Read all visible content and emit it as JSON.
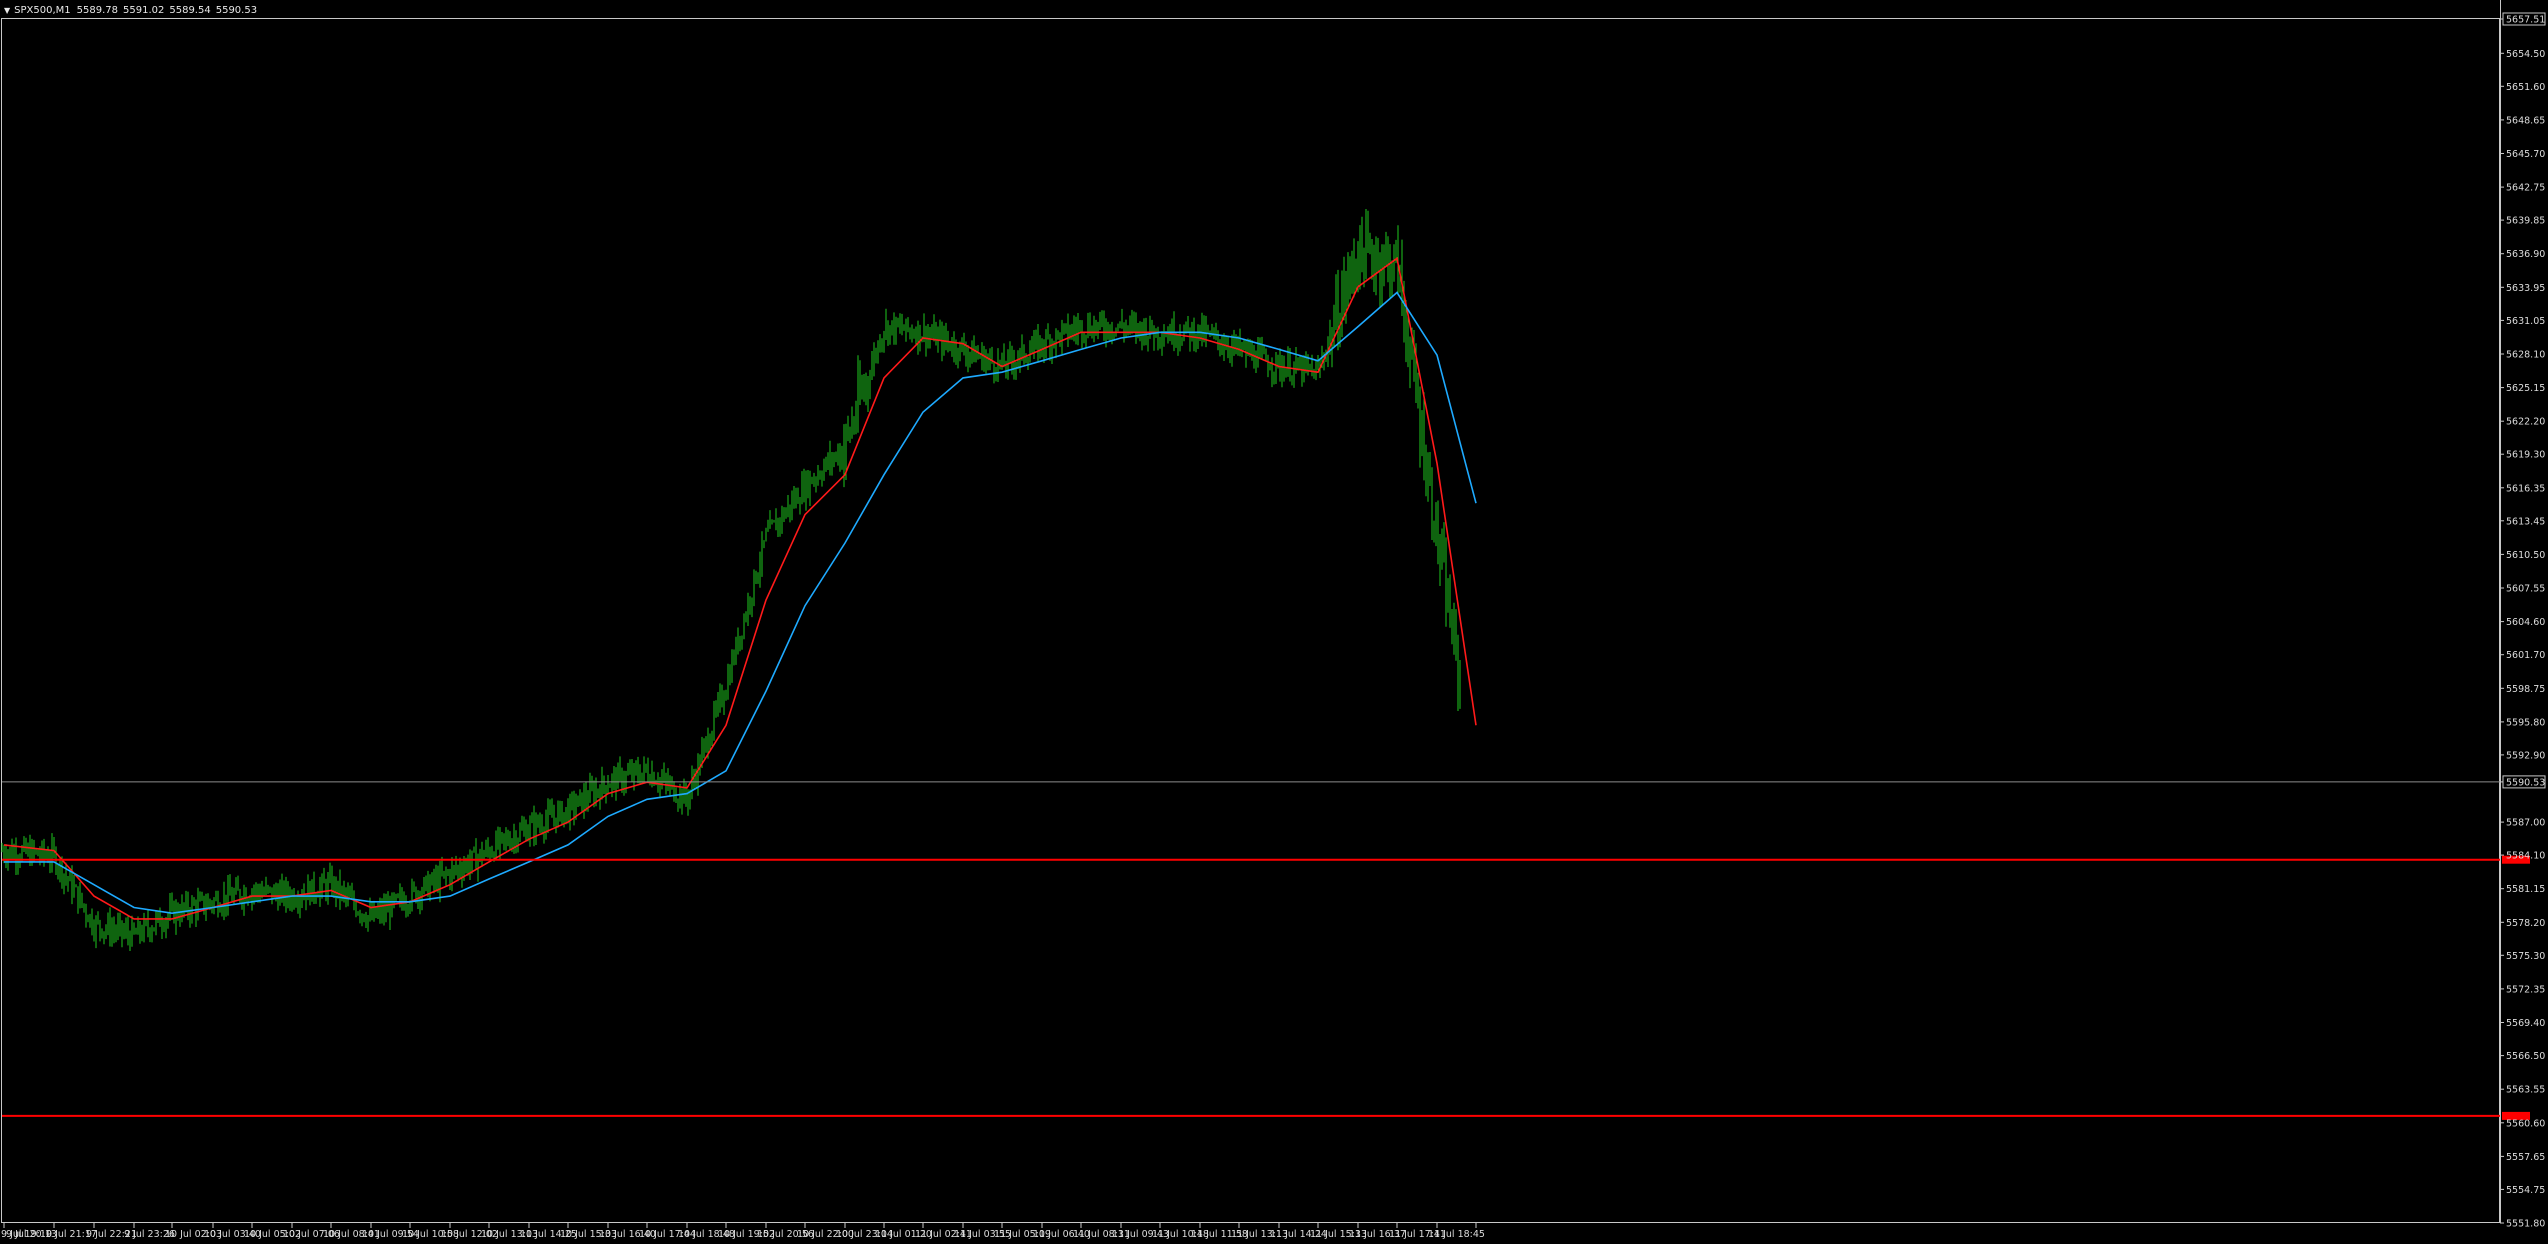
{
  "header": {
    "symbol": "SPX500,M1",
    "open": "5589.78",
    "high": "5591.02",
    "low": "5589.54",
    "close": "5590.53",
    "menu_icon": "triangle-down-icon"
  },
  "colors": {
    "background": "#000000",
    "frame": "#c8c8c8",
    "candles": "#1ec81e",
    "ma_fast": "#ff1a1a",
    "ma_slow": "#1eaaff",
    "h_lines": "#ff0000",
    "current_price_line": "#8c8c8c",
    "text": "#dcdcdc"
  },
  "price_axis": {
    "ticks": [
      "5657.51",
      "5654.50",
      "5651.60",
      "5648.65",
      "5645.70",
      "5642.75",
      "5639.85",
      "5636.90",
      "5633.95",
      "5631.05",
      "5628.10",
      "5625.15",
      "5622.20",
      "5619.30",
      "5616.35",
      "5613.45",
      "5610.50",
      "5607.55",
      "5604.60",
      "5601.70",
      "5598.75",
      "5595.80",
      "5592.90",
      "5590.53",
      "5587.00",
      "5584.10",
      "5581.15",
      "5578.20",
      "5575.30",
      "5572.35",
      "5569.40",
      "5566.50",
      "5563.55",
      "5560.60",
      "5557.65",
      "5554.75",
      "5551.80"
    ]
  },
  "time_axis": {
    "ticks": [
      "9 Jul 19:10",
      "9 Jul 20:13",
      "9 Jul 21:17",
      "9 Jul 22:21",
      "9 Jul 23:26",
      "10 Jul 02:03",
      "10 Jul 03:40",
      "10 Jul 05:02",
      "10 Jul 07:06",
      "10 Jul 08:41",
      "10 Jul 09:54",
      "10 Jul 10:58",
      "10 Jul 12:02",
      "10 Jul 13:13",
      "10 Jul 14:25",
      "10 Jul 15:33",
      "10 Jul 16:40",
      "10 Jul 17:44",
      "10 Jul 18:48",
      "10 Jul 19:52",
      "10 Jul 20:56",
      "10 Jul 22:00",
      "10 Jul 23:04",
      "11 Jul 01:20",
      "11 Jul 02:41",
      "11 Jul 03:55",
      "11 Jul 05:09",
      "11 Jul 06:40",
      "11 Jul 08:31",
      "11 Jul 09:43",
      "11 Jul 10:48",
      "11 Jul 11:58",
      "11 Jul 13:13",
      "11 Jul 14:24",
      "11 Jul 15:33",
      "11 Jul 16:37",
      "11 Jul 17:41",
      "11 Jul 18:45"
    ]
  },
  "chart_data": {
    "type": "line",
    "instrument": "SPX500",
    "timeframe": "M1",
    "ylim": [
      5551.8,
      5657.51
    ],
    "x": [
      "9 Jul 19:10",
      "9 Jul 20:13",
      "9 Jul 21:17",
      "9 Jul 22:21",
      "9 Jul 23:26",
      "10 Jul 02:03",
      "10 Jul 03:40",
      "10 Jul 05:02",
      "10 Jul 07:06",
      "10 Jul 08:41",
      "10 Jul 09:54",
      "10 Jul 10:58",
      "10 Jul 12:02",
      "10 Jul 13:13",
      "10 Jul 14:25",
      "10 Jul 15:33",
      "10 Jul 16:40",
      "10 Jul 17:44",
      "10 Jul 18:48",
      "10 Jul 19:52",
      "10 Jul 20:56",
      "10 Jul 22:00",
      "10 Jul 23:04",
      "11 Jul 01:20",
      "11 Jul 02:41",
      "11 Jul 03:55",
      "11 Jul 05:09",
      "11 Jul 06:40",
      "11 Jul 08:31",
      "11 Jul 09:43",
      "11 Jul 10:48",
      "11 Jul 11:58",
      "11 Jul 13:13",
      "11 Jul 14:24",
      "11 Jul 15:33",
      "11 Jul 16:37",
      "11 Jul 17:41",
      "11 Jul 18:45"
    ],
    "series": [
      {
        "values": [
          5584.5,
          5584.0,
          5578.0,
          5577.0,
          5579.0,
          5580.0,
          5581.0,
          5580.5,
          5581.5,
          5578.5,
          5580.5,
          5582.5,
          5584.5,
          5586.5,
          5588.0,
          5590.5,
          5591.5,
          5589.0,
          5599.0,
          5612.0,
          5616.5,
          5620.0,
          5630.5,
          5630.0,
          5628.5,
          5627.0,
          5629.0,
          5630.5,
          5630.5,
          5630.0,
          5630.0,
          5628.5,
          5627.0,
          5626.5,
          5637.0,
          5636.0,
          5612.0,
          5590.5
        ]
      },
      {
        "values": [
          5585.0,
          5584.5,
          5580.5,
          5578.5,
          5578.5,
          5579.5,
          5580.5,
          5580.5,
          5581.0,
          5579.5,
          5580.0,
          5581.5,
          5583.5,
          5585.5,
          5587.0,
          5589.5,
          5590.5,
          5590.0,
          5595.5,
          5606.5,
          5614.0,
          5617.5,
          5626.0,
          5629.5,
          5629.0,
          5627.0,
          5628.5,
          5630.0,
          5630.0,
          5630.0,
          5629.5,
          5628.5,
          5627.0,
          5626.5,
          5634.0,
          5636.5,
          5618.5,
          5595.5
        ]
      },
      {
        "values": [
          5583.5,
          5583.5,
          5581.5,
          5579.5,
          5579.0,
          5579.5,
          5580.0,
          5580.5,
          5580.5,
          5580.0,
          5580.0,
          5580.5,
          5582.0,
          5583.5,
          5585.0,
          5587.5,
          5589.0,
          5589.5,
          5591.5,
          5598.5,
          5606.0,
          5611.5,
          5617.5,
          5623.0,
          5626.0,
          5626.5,
          5627.5,
          5628.5,
          5629.5,
          5630.0,
          5630.0,
          5629.5,
          5628.5,
          5627.5,
          5630.5,
          5633.5,
          5628.0,
          5615.0
        ]
      }
    ],
    "horizontal_lines": [
      5583.7,
      5561.2
    ],
    "current_price": 5590.53
  }
}
